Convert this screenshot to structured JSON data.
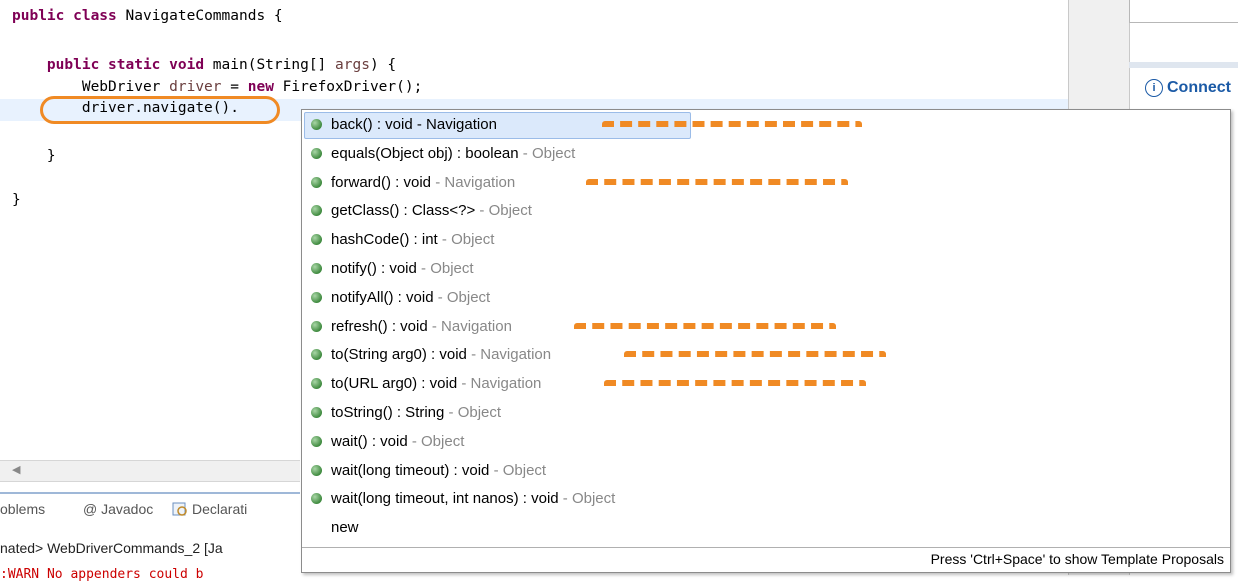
{
  "editor": {
    "code_lines": [
      {
        "parts": [
          {
            "t": "public class ",
            "c": "kw"
          },
          {
            "t": "NavigateCommands {",
            "c": ""
          }
        ]
      },
      {
        "parts": [
          {
            "t": "    public static void ",
            "c": "kw"
          },
          {
            "t": "main(String[] ",
            "c": ""
          },
          {
            "t": "args",
            "c": "var"
          },
          {
            "t": ") {",
            "c": ""
          }
        ]
      },
      {
        "parts": [
          {
            "t": "        WebDriver ",
            "c": ""
          },
          {
            "t": "driver",
            "c": "var"
          },
          {
            "t": " = ",
            "c": ""
          },
          {
            "t": "new ",
            "c": "kw"
          },
          {
            "t": "FirefoxDriver();",
            "c": ""
          }
        ]
      },
      {
        "parts": [
          {
            "t": "        driver.navigate().",
            "c": ""
          }
        ]
      },
      {
        "parts": [
          {
            "t": "    }",
            "c": ""
          }
        ]
      },
      {
        "parts": [
          {
            "t": "}",
            "c": ""
          }
        ]
      }
    ]
  },
  "right_panel": {
    "connect_label": "Connect",
    "info_symbol": "i"
  },
  "bottom": {
    "tab_problems": "oblems",
    "tab_javadoc": "@ Javadoc",
    "tab_declaration": "Declarati",
    "console_line": "nated> WebDriverCommands_2 [Ja",
    "warn_line": ":WARN No appenders could b"
  },
  "popup": {
    "items": [
      {
        "sig": "back() : void",
        "owner": "Navigation",
        "icon": "public-method-icon",
        "selected": true,
        "marked": true
      },
      {
        "sig": "equals(Object obj) : boolean",
        "owner": "Object",
        "icon": "public-method-icon",
        "selected": false,
        "marked": false
      },
      {
        "sig": "forward() : void",
        "owner": "Navigation",
        "icon": "public-method-icon",
        "selected": false,
        "marked": true
      },
      {
        "sig": "getClass() : Class<?>",
        "owner": "Object",
        "icon": "public-method-icon",
        "selected": false,
        "marked": false
      },
      {
        "sig": "hashCode() : int",
        "owner": "Object",
        "icon": "public-method-icon",
        "selected": false,
        "marked": false
      },
      {
        "sig": "notify() : void",
        "owner": "Object",
        "icon": "public-method-icon",
        "selected": false,
        "marked": false
      },
      {
        "sig": "notifyAll() : void",
        "owner": "Object",
        "icon": "public-method-icon",
        "selected": false,
        "marked": false
      },
      {
        "sig": "refresh() : void",
        "owner": "Navigation",
        "icon": "public-method-icon",
        "selected": false,
        "marked": true
      },
      {
        "sig": "to(String arg0) : void",
        "owner": "Navigation",
        "icon": "public-method-icon",
        "selected": false,
        "marked": true
      },
      {
        "sig": "to(URL arg0) : void",
        "owner": "Navigation",
        "icon": "public-method-icon",
        "selected": false,
        "marked": true
      },
      {
        "sig": "toString() : String",
        "owner": "Object",
        "icon": "public-method-icon",
        "selected": false,
        "marked": false
      },
      {
        "sig": "wait() : void",
        "owner": "Object",
        "icon": "public-method-icon",
        "selected": false,
        "marked": false
      },
      {
        "sig": "wait(long timeout) : void",
        "owner": "Object",
        "icon": "public-method-icon",
        "selected": false,
        "marked": false
      },
      {
        "sig": "wait(long timeout, int nanos) : void",
        "owner": "Object",
        "icon": "public-method-icon",
        "selected": false,
        "marked": false
      },
      {
        "sig": "new",
        "owner": "",
        "icon": "",
        "selected": false,
        "marked": false
      }
    ],
    "footer": "Press 'Ctrl+Space' to show Template Proposals"
  },
  "colors": {
    "keyword": "#7f0055",
    "highlight_annotation": "#f08a24",
    "connect_blue": "#1b5aa6",
    "method_icon_green": "#3f8a3f"
  }
}
